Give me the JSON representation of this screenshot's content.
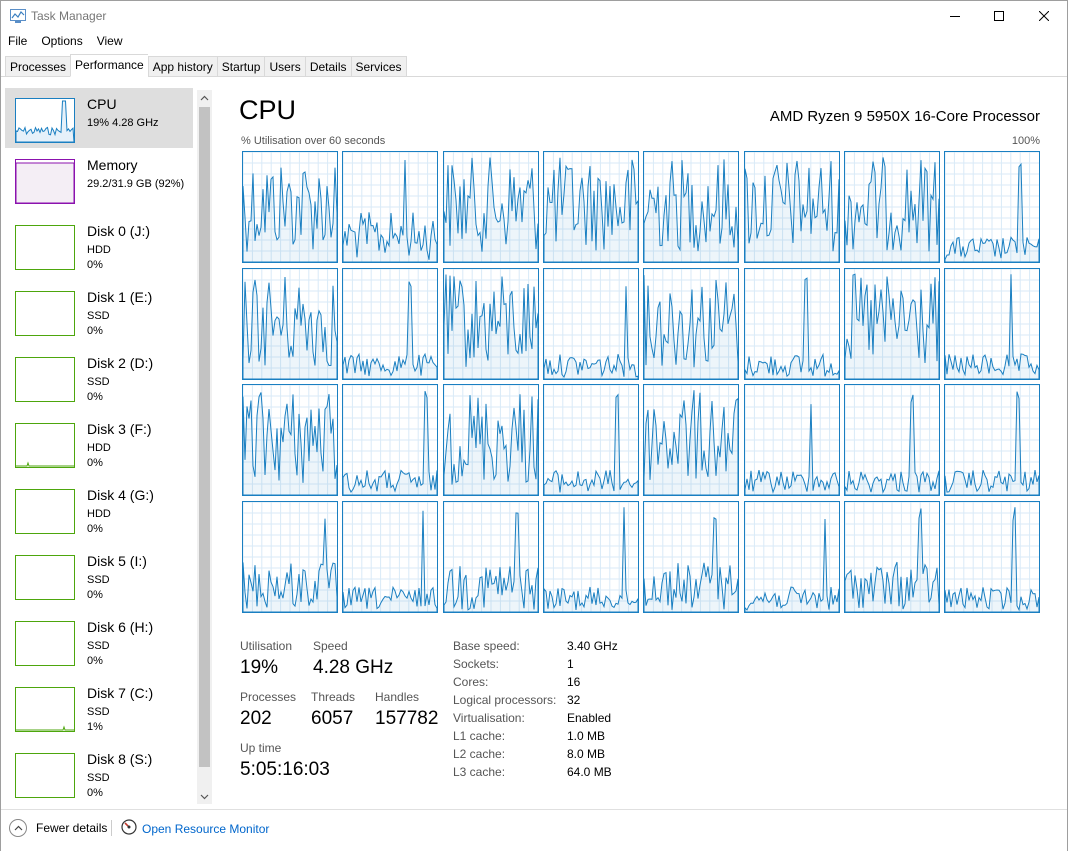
{
  "window": {
    "title": "Task Manager"
  },
  "menu": [
    "File",
    "Options",
    "View"
  ],
  "tabs": [
    "Processes",
    "Performance",
    "App history",
    "Startup",
    "Users",
    "Details",
    "Services"
  ],
  "active_tab": "Performance",
  "sidebar": [
    {
      "title": "CPU",
      "line1": "19%  4.28 GHz",
      "line2": "",
      "kind": "cpu"
    },
    {
      "title": "Memory",
      "line1": "29.2/31.9 GB (92%)",
      "line2": "",
      "kind": "memory"
    },
    {
      "title": "Disk 0 (J:)",
      "line1": "HDD",
      "line2": "0%",
      "kind": "disk"
    },
    {
      "title": "Disk 1 (E:)",
      "line1": "SSD",
      "line2": "0%",
      "kind": "disk"
    },
    {
      "title": "Disk 2 (D:)",
      "line1": "SSD",
      "line2": "0%",
      "kind": "disk"
    },
    {
      "title": "Disk 3 (F:)",
      "line1": "HDD",
      "line2": "0%",
      "kind": "disk"
    },
    {
      "title": "Disk 4 (G:)",
      "line1": "HDD",
      "line2": "0%",
      "kind": "disk"
    },
    {
      "title": "Disk 5 (I:)",
      "line1": "SSD",
      "line2": "0%",
      "kind": "disk"
    },
    {
      "title": "Disk 6 (H:)",
      "line1": "SSD",
      "line2": "0%",
      "kind": "disk"
    },
    {
      "title": "Disk 7 (C:)",
      "line1": "SSD",
      "line2": "1%",
      "kind": "disk"
    },
    {
      "title": "Disk 8 (S:)",
      "line1": "SSD",
      "line2": "0%",
      "kind": "disk"
    }
  ],
  "main": {
    "title": "CPU",
    "model": "AMD Ryzen 9 5950X 16-Core Processor",
    "graph_label": "% Utilisation over 60 seconds",
    "graph_max": "100%",
    "logical_processor_graphs": 32
  },
  "stats": {
    "utilisation_label": "Utilisation",
    "utilisation": "19%",
    "speed_label": "Speed",
    "speed": "4.28 GHz",
    "processes_label": "Processes",
    "processes": "202",
    "threads_label": "Threads",
    "threads": "6057",
    "handles_label": "Handles",
    "handles": "157782",
    "uptime_label": "Up time",
    "uptime": "5:05:16:03"
  },
  "specs": [
    {
      "label": "Base speed:",
      "value": "3.40 GHz"
    },
    {
      "label": "Sockets:",
      "value": "1"
    },
    {
      "label": "Cores:",
      "value": "16"
    },
    {
      "label": "Logical processors:",
      "value": "32"
    },
    {
      "label": "Virtualisation:",
      "value": "Enabled"
    },
    {
      "label": "L1 cache:",
      "value": "1.0 MB"
    },
    {
      "label": "L2 cache:",
      "value": "8.0 MB"
    },
    {
      "label": "L3 cache:",
      "value": "64.0 MB"
    }
  ],
  "footer": {
    "fewer_details": "Fewer details",
    "open_resmon": "Open Resource Monitor"
  },
  "colors": {
    "cpu": "#1a7fc1",
    "memory": "#8b12ae",
    "disk": "#4da60c"
  }
}
